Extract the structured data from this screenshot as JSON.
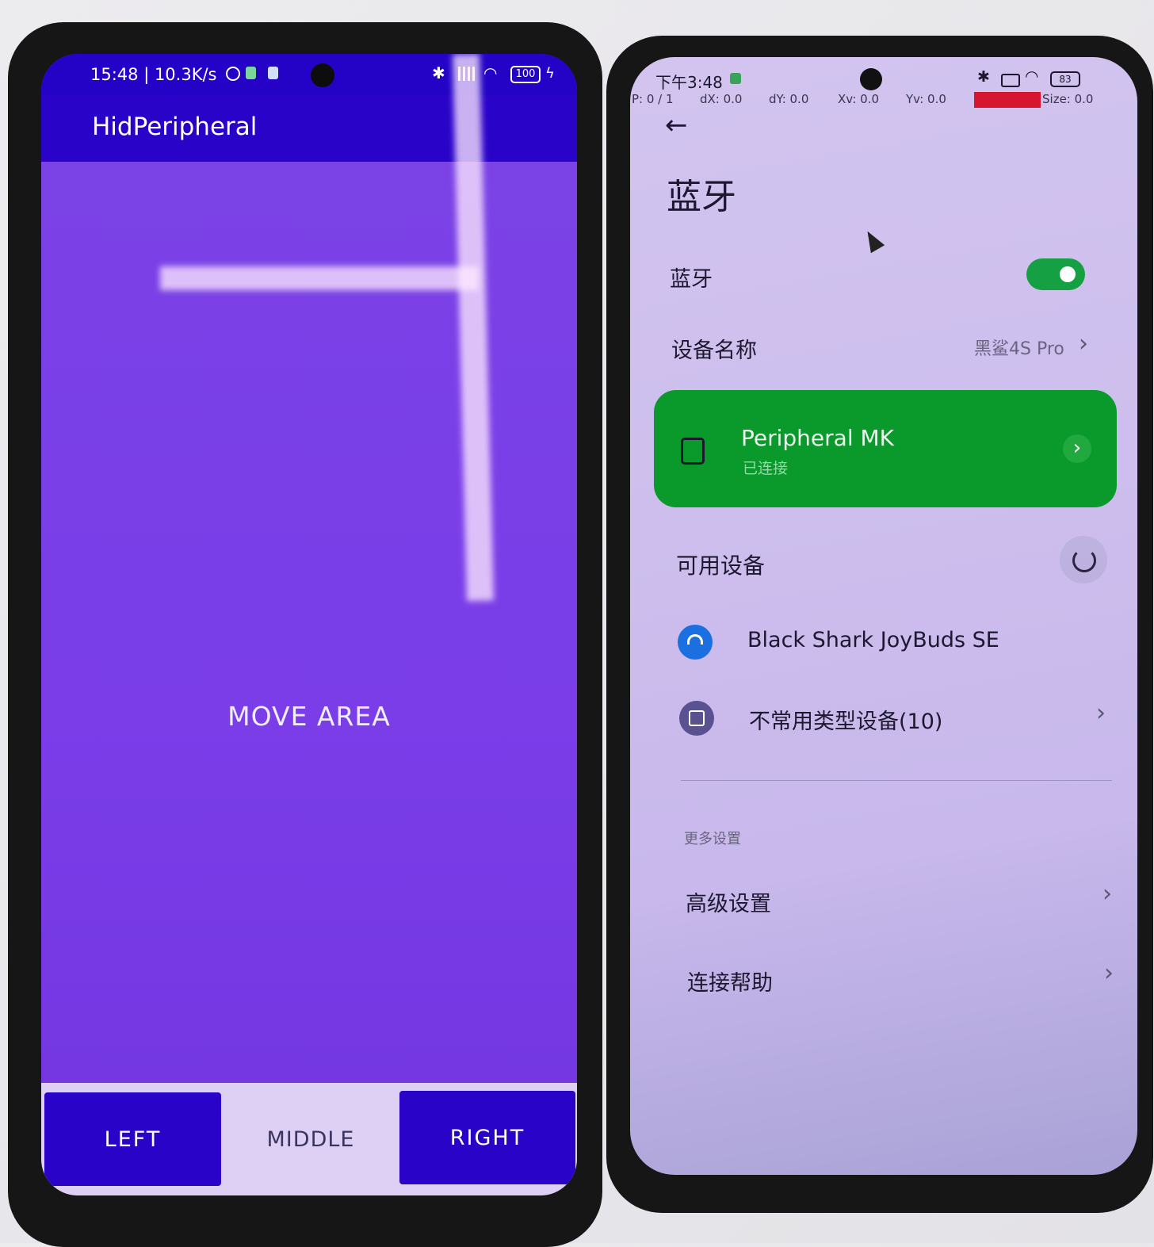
{
  "left_phone": {
    "status_bar": {
      "time_speed": "15:48 | 10.3K/s",
      "battery": "100"
    },
    "app_title": "HidPeripheral",
    "move_area_label": "MOVE AREA",
    "buttons": {
      "left": "LEFT",
      "middle": "MIDDLE",
      "right": "RIGHT"
    },
    "colors": {
      "app_bar": "#2a03c9",
      "move_area": "#7a3de6",
      "button": "#2a03c9"
    }
  },
  "right_phone": {
    "status_bar": {
      "time": "下午3:48",
      "battery": "83"
    },
    "pointer_overlay": {
      "p": "P: 0 / 1",
      "dx": "dX: 0.0",
      "dy": "dY: 0.0",
      "xv": "Xv: 0.0",
      "yv": "Yv: 0.0",
      "size": "Size: 0.0"
    },
    "page_title": "蓝牙",
    "bluetooth_toggle": {
      "label": "蓝牙",
      "on": true
    },
    "device_name": {
      "label": "设备名称",
      "value": "黑鲨4S Pro"
    },
    "connected_device": {
      "name": "Peripheral MK",
      "status": "已连接"
    },
    "available_section": {
      "title": "可用设备",
      "devices": [
        {
          "name": "Black Shark JoyBuds SE",
          "icon": "headphones-icon"
        },
        {
          "name": "不常用类型设备(10)",
          "icon": "device-icon"
        }
      ]
    },
    "more_settings": {
      "header": "更多设置",
      "items": [
        "高级设置",
        "连接帮助"
      ]
    },
    "colors": {
      "connected_card": "#0a9a2b",
      "toggle": "#14a043",
      "headphones_icon": "#1b6fe0"
    }
  }
}
